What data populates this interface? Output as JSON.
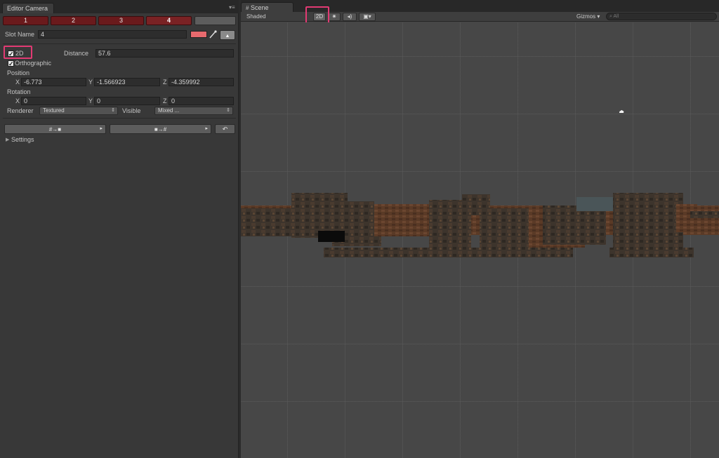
{
  "left_panel": {
    "tab_title": "Editor Camera",
    "slots": [
      "1",
      "2",
      "3",
      "4"
    ],
    "active_slot": "4",
    "slot_name_label": "Slot Name",
    "slot_name_value": "4",
    "slot_color": "#e86a6e",
    "two_d_label": "2D",
    "two_d_checked": true,
    "orthographic_label": "Orthographic",
    "orthographic_checked": true,
    "distance_label": "Distance",
    "distance_value": "57.6",
    "position_label": "Position",
    "position": {
      "x_label": "X",
      "x": "-6.773",
      "y_label": "Y",
      "y": "-1.566923",
      "z_label": "Z",
      "z": "-4.359992"
    },
    "rotation_label": "Rotation",
    "rotation": {
      "x_label": "X",
      "x": "0",
      "y_label": "Y",
      "y": "0",
      "z_label": "Z",
      "z": "0"
    },
    "renderer_label": "Renderer",
    "renderer_value": "Textured",
    "visible_label": "Visible",
    "visible_value": "Mixed ...",
    "settings_label": "Settings"
  },
  "scene_panel": {
    "tab_title": "Scene",
    "shading_mode": "Shaded",
    "two_d_button": "2D",
    "gizmos_label": "Gizmos",
    "search_placeholder": "All"
  },
  "colors": {
    "highlight": "#e23a73",
    "slot_red": "#6a1a1c"
  }
}
